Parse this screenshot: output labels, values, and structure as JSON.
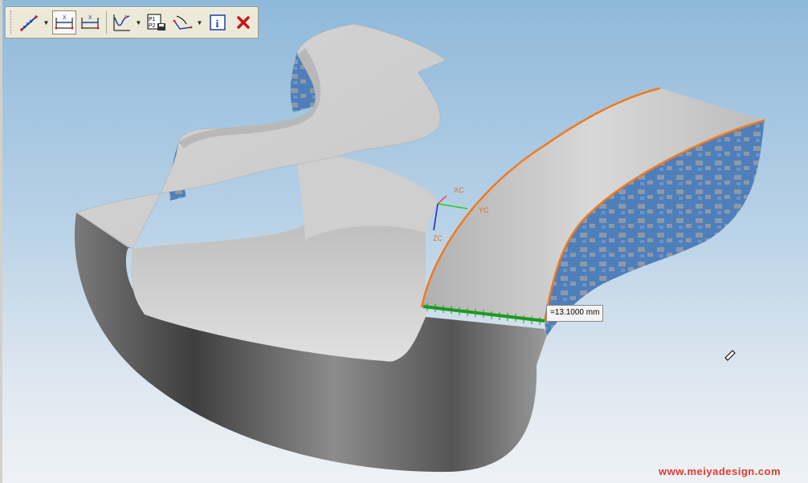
{
  "toolbar": {
    "buttons": [
      {
        "name": "measure-distance",
        "icon": "ruler-diagonal-icon",
        "has_dropdown": true
      },
      {
        "name": "horizontal-dimension",
        "icon": "horizontal-dimension-icon",
        "active": true
      },
      {
        "name": "horizontal-dimension-2",
        "icon": "horizontal-dimension-alt-icon"
      },
      {
        "name": "curve-analysis",
        "icon": "curve-graph-icon",
        "has_dropdown": true
      },
      {
        "name": "point-to-point",
        "icon": "p1-p2-icon",
        "p1": "P1",
        "p2": "P2"
      },
      {
        "name": "angle-measure",
        "icon": "angle-dimension-icon",
        "has_dropdown": true
      },
      {
        "name": "information",
        "icon": "info-icon",
        "glyph": "i"
      },
      {
        "name": "close",
        "icon": "close-icon",
        "glyph": "✕"
      }
    ]
  },
  "viewport": {
    "axes": {
      "x": "XC",
      "y": "YC",
      "z": "ZC"
    },
    "measurement": "=13.1000 mm",
    "colors": {
      "edge_highlight": "#f07a1e",
      "measure_line": "#1d9a1d",
      "axis_x": "#e44",
      "axis_y": "#2c2",
      "axis_z": "#22c"
    }
  },
  "watermark": "www.meiyadesign.com"
}
